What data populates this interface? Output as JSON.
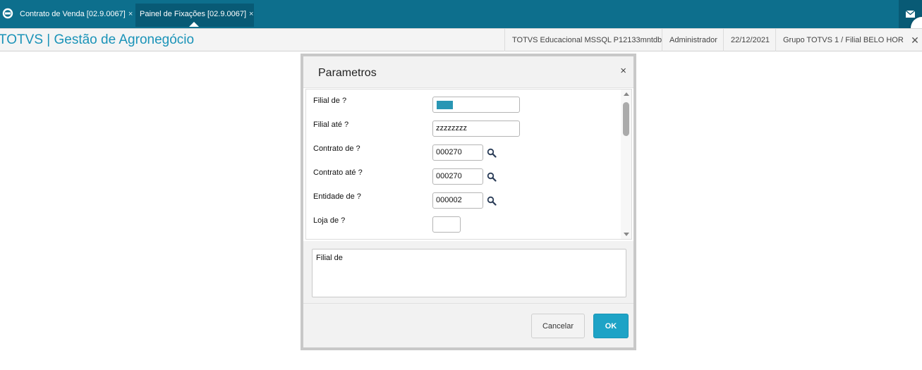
{
  "tabs": [
    {
      "label": "Contrato de Venda [02.9.0067]",
      "close": "×"
    },
    {
      "label": "Painel de Fixações [02.9.0067]",
      "close": "×"
    }
  ],
  "app": {
    "title": "TOTVS | Gestão de Agronegócio",
    "database": "TOTVS Educacional MSSQL P12133mntdb",
    "user": "Administrador",
    "date": "22/12/2021",
    "branch": "Grupo TOTVS 1 / Filial BELO HOR",
    "close": "✕"
  },
  "dialog": {
    "title": "Parametros",
    "close": "×",
    "params": [
      {
        "label": "Filial de ?",
        "value": ""
      },
      {
        "label": "Filial até ?",
        "value": "zzzzzzzz"
      },
      {
        "label": "Contrato de ?",
        "value": "000270"
      },
      {
        "label": "Contrato até ?",
        "value": "000270"
      },
      {
        "label": "Entidade de ?",
        "value": "000002"
      },
      {
        "label": "Loja de ?",
        "value": ""
      }
    ],
    "help_text": "Filial de",
    "cancel_label": "Cancelar",
    "ok_label": "OK"
  },
  "colors": {
    "tabbar": "#0d6f8d",
    "active_tab": "#085a75",
    "accent": "#1a93b8",
    "ok_button": "#1ea3c6"
  },
  "icons": [
    "totvs-logo-icon",
    "close-icon",
    "mail-icon",
    "search-icon",
    "scroll-up-icon",
    "scroll-down-icon"
  ]
}
